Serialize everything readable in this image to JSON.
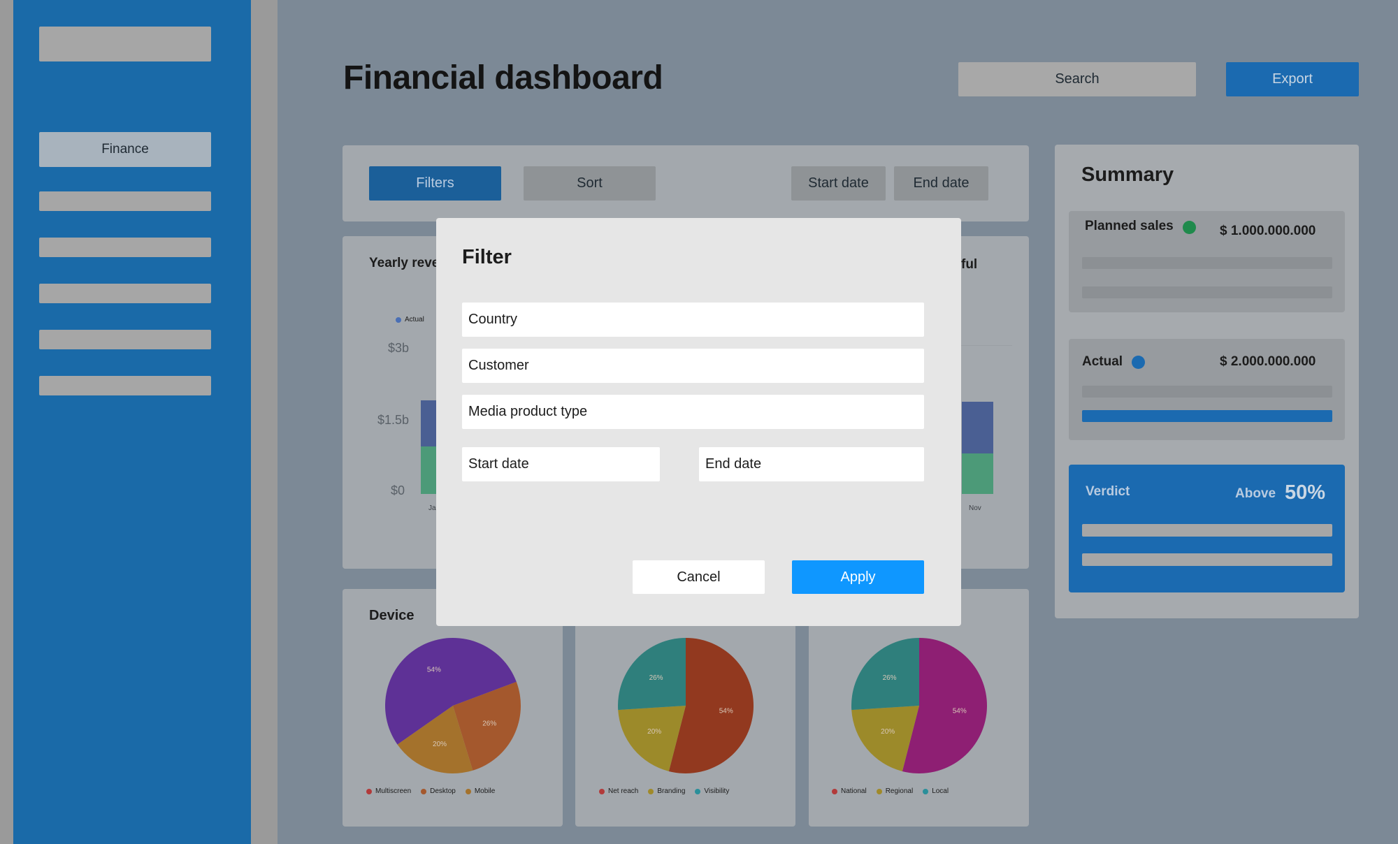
{
  "sidebar": {
    "active_item": "Finance"
  },
  "header": {
    "title": "Financial dashboard",
    "search_label": "Search",
    "export_label": "Export"
  },
  "toolbar": {
    "filters_label": "Filters",
    "sort_label": "Sort",
    "start_date_label": "Start date",
    "end_date_label": "End date"
  },
  "revenue_chart": {
    "title_fragment_left": "Yearly reve",
    "title_fragment_right": "ful",
    "legend_actual": "Actual",
    "y_ticks": [
      "$3b",
      "$1.5b",
      "$0"
    ],
    "x_first": "Ja",
    "x_last": "Nov"
  },
  "pies": [
    {
      "title": "Device",
      "slices": [
        {
          "label": "54%",
          "value": 54,
          "color": "#5e3196"
        },
        {
          "label": "26%",
          "value": 26,
          "color": "#a4582d"
        },
        {
          "label": "20%",
          "value": 20,
          "color": "#a4722c"
        }
      ],
      "legend": [
        {
          "label": "Multiscreen",
          "color": "#b23a3a"
        },
        {
          "label": "Desktop",
          "color": "#a4582d"
        },
        {
          "label": "Mobile",
          "color": "#a4722c"
        }
      ]
    },
    {
      "title": "",
      "slices": [
        {
          "label": "54%",
          "value": 54,
          "color": "#92391f"
        },
        {
          "label": "20%",
          "value": 20,
          "color": "#9c8a2a"
        },
        {
          "label": "26%",
          "value": 26,
          "color": "#2f7f7c"
        }
      ],
      "legend": [
        {
          "label": "Net reach",
          "color": "#b23a3a"
        },
        {
          "label": "Branding",
          "color": "#a08a2a"
        },
        {
          "label": "Visibility",
          "color": "#2a8f9a"
        }
      ]
    },
    {
      "title": "",
      "slices": [
        {
          "label": "54%",
          "value": 54,
          "color": "#8e1f73"
        },
        {
          "label": "20%",
          "value": 20,
          "color": "#9c8a2a"
        },
        {
          "label": "26%",
          "value": 26,
          "color": "#2f7f7c"
        }
      ],
      "legend": [
        {
          "label": "National",
          "color": "#b23a3a"
        },
        {
          "label": "Regional",
          "color": "#a08a2a"
        },
        {
          "label": "Local",
          "color": "#2a8f9a"
        }
      ]
    }
  ],
  "summary": {
    "title": "Summary",
    "planned_label": "Planned sales",
    "planned_value": "$ 1.000.000.000",
    "planned_color": "#1f8a4c",
    "actual_label": "Actual",
    "actual_value": "$ 2.000.000.000",
    "actual_color": "#1b6ab0",
    "verdict_label": "Verdict",
    "verdict_above": "Above",
    "verdict_percent": "50%"
  },
  "modal": {
    "title": "Filter",
    "country_label": "Country",
    "customer_label": "Customer",
    "media_label": "Media product type",
    "start_date_label": "Start date",
    "end_date_label": "End date",
    "cancel_label": "Cancel",
    "apply_label": "Apply"
  }
}
